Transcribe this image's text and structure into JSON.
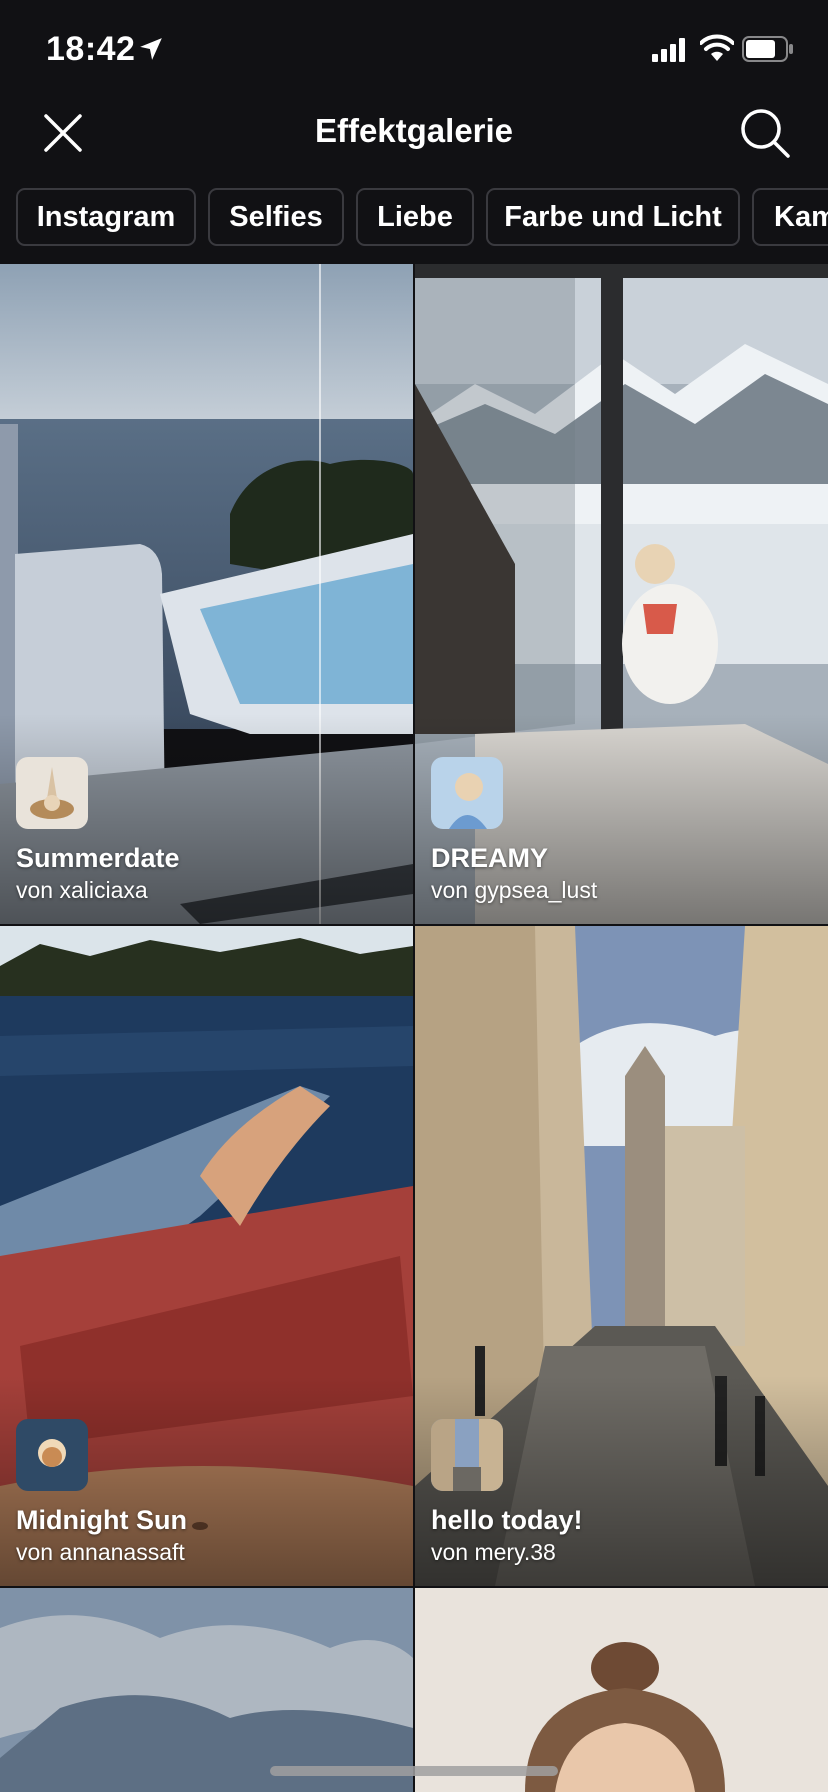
{
  "status_bar": {
    "time": "18:42",
    "battery_level": 0.7
  },
  "header": {
    "title": "Effektgalerie"
  },
  "categories": [
    "Instagram",
    "Selfies",
    "Liebe",
    "Farbe und Licht",
    "Kam"
  ],
  "effects": [
    {
      "name": "Summerdate",
      "author": "von xaliciaxa"
    },
    {
      "name": "DREAMY",
      "author": "von gypsea_lust"
    },
    {
      "name": "Midnight Sun",
      "author": "von annanassaft"
    },
    {
      "name": "hello today!",
      "author": "von mery.38"
    }
  ],
  "colors": {
    "background": "#111114",
    "chip_border": "#3a3a3f",
    "text": "#ffffff"
  }
}
